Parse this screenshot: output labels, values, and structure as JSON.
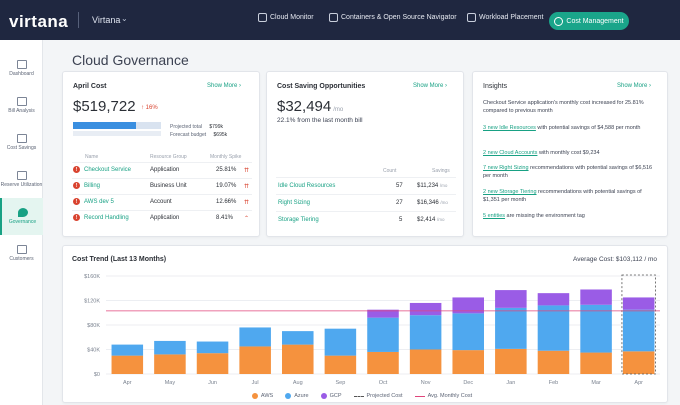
{
  "topbar": {
    "brand": "virtana",
    "tenant": "Virtana",
    "nav": [
      {
        "label": "Cloud Monitor",
        "icon": "monitor-icon"
      },
      {
        "label": "Containers & Open Source Navigator",
        "icon": "container-icon"
      },
      {
        "label": "Workload Placement",
        "icon": "cloud-icon"
      }
    ],
    "active_nav": {
      "label": "Cost Management",
      "icon": "dollar-icon"
    }
  },
  "sidebar": {
    "items": [
      {
        "label": "Dashboard",
        "icon": "dashboard-icon",
        "active": false
      },
      {
        "label": "Bill Analysis",
        "icon": "bill-icon",
        "active": false
      },
      {
        "label": "Cost Savings",
        "icon": "savings-icon",
        "active": false
      },
      {
        "label": "Reserve Utilization",
        "icon": "reserve-icon",
        "active": false
      },
      {
        "label": "Governance",
        "icon": "shield-icon",
        "active": true
      },
      {
        "label": "Customers",
        "icon": "customers-icon",
        "active": false
      }
    ]
  },
  "page": {
    "title": "Cloud Governance"
  },
  "april_cost": {
    "title": "April Cost",
    "show_more": "Show More ›",
    "value": "$519,722",
    "delta": "↑ 16%",
    "legend_total": "Projected total",
    "legend_total_value": "$799k",
    "legend_budget": "Forecast budget",
    "legend_budget_value": "$695k",
    "bar_fill_fraction": 0.72,
    "headers": [
      "Name",
      "Resource Group",
      "Monthly Spike"
    ],
    "rows": [
      {
        "name": "Checkout Service",
        "group": "Application",
        "spike": "25.81%"
      },
      {
        "name": "Billing",
        "group": "Business Unit",
        "spike": "19.07%"
      },
      {
        "name": "AWS dev 5",
        "group": "Account",
        "spike": "12.66%"
      },
      {
        "name": "Record Handling",
        "group": "Application",
        "spike": "8.41%"
      }
    ]
  },
  "savings": {
    "title": "Cost Saving Opportunities",
    "show_more": "Show More ›",
    "value": "$32,494",
    "unit": "/mo",
    "subline": "22.1% from the last month bill",
    "headers": [
      "Count",
      "Savings"
    ],
    "rows": [
      {
        "name": "Idle Cloud Resources",
        "count": "57",
        "savings": "$11,234",
        "unit": "/mo"
      },
      {
        "name": "Right Sizing",
        "count": "27",
        "savings": "$16,346",
        "unit": "/mo"
      },
      {
        "name": "Storage Tiering",
        "count": "5",
        "savings": "$2,414",
        "unit": "/mo"
      }
    ]
  },
  "insights": {
    "title": "Insights",
    "show_more": "Show More ›",
    "items": [
      {
        "link": "",
        "text": "Checkout Service application's monthly cost increased for 25.81% compared to previous month"
      },
      {
        "link": "3 new Idle Resources",
        "text": " with potential savings of $4,588 per month"
      },
      {
        "link": "2 new Cloud Accounts",
        "text": " with monthly cost $9,234"
      },
      {
        "link": "7 new Right Sizing",
        "text": " recommendations with potential savings of $6,516 per month"
      },
      {
        "link": "2 new Storage Tiering",
        "text": " recommendations with potential savings of $1,351 per month"
      },
      {
        "link": "5 entities",
        "text": " are missing the environment tag"
      }
    ]
  },
  "trend": {
    "title": "Cost Trend (Last 13 Months)",
    "average": "Average Cost: $103,112 / mo"
  },
  "chart_data": {
    "type": "bar",
    "title": "Cost Trend (Last 13 Months)",
    "categories": [
      "Apr",
      "May",
      "Jun",
      "Jul",
      "Aug",
      "Sep",
      "Oct",
      "Nov",
      "Dec",
      "Jan",
      "Feb",
      "Mar",
      "Apr"
    ],
    "y_ticks": [
      "$0",
      "$40K",
      "$80K",
      "$120K",
      "$160K"
    ],
    "ylim": [
      0,
      160000
    ],
    "stacked": true,
    "series": [
      {
        "name": "AWS",
        "color": "#f5923e",
        "values": [
          30000,
          32000,
          34000,
          45000,
          48000,
          30000,
          36000,
          40000,
          39000,
          41000,
          38000,
          35000,
          37000
        ]
      },
      {
        "name": "Azure",
        "color": "#4fa8ef",
        "values": [
          18000,
          22000,
          19000,
          31000,
          22000,
          44000,
          56000,
          56000,
          60000,
          67000,
          74000,
          78000,
          68000
        ]
      },
      {
        "name": "GCP",
        "color": "#9a5ce6",
        "values": [
          0,
          0,
          0,
          0,
          0,
          0,
          13000,
          20000,
          26000,
          29000,
          20000,
          25000,
          20000
        ]
      }
    ],
    "projected_last": true,
    "average_line": 103112,
    "legend": [
      "AWS",
      "Azure",
      "GCP",
      "Projected Cost",
      "Avg. Monthly Cost"
    ],
    "legend_colors": {
      "avg": "#e0457b",
      "projected": "#555555"
    }
  }
}
